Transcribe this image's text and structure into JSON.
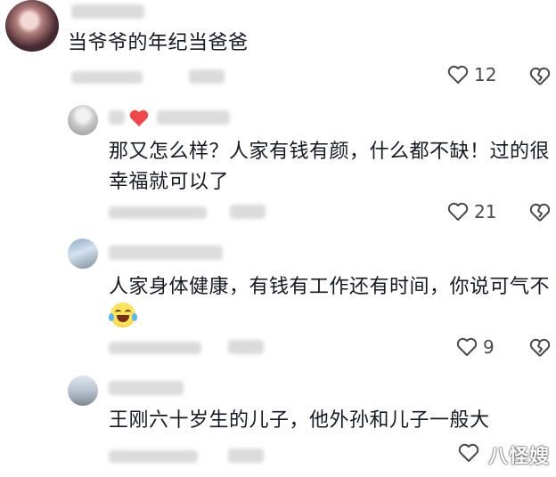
{
  "comments": [
    {
      "text": "当爷爷的年纪当爸爸",
      "likes": "12"
    },
    {
      "text": "那又怎么样？人家有钱有颜，什么都不缺！过的很幸福就可以了",
      "likes": "21"
    },
    {
      "text": "人家身体健康，有钱有工作还有时间，你说可气不",
      "likes": "9"
    },
    {
      "text": "王刚六十岁生的儿子，他外孙和儿子一般大",
      "likes": ""
    }
  ],
  "watermark": "八怪嫂",
  "icons": {
    "like": "heart-outline-icon",
    "dislike": "broken-heart-icon",
    "emoji": "laughing-crying-emoji-icon",
    "badge": "red-heart-icon"
  },
  "colors": {
    "text": "#161823",
    "meta": "#4a4a4a",
    "background": "#ffffff",
    "badge": "#f04848"
  }
}
